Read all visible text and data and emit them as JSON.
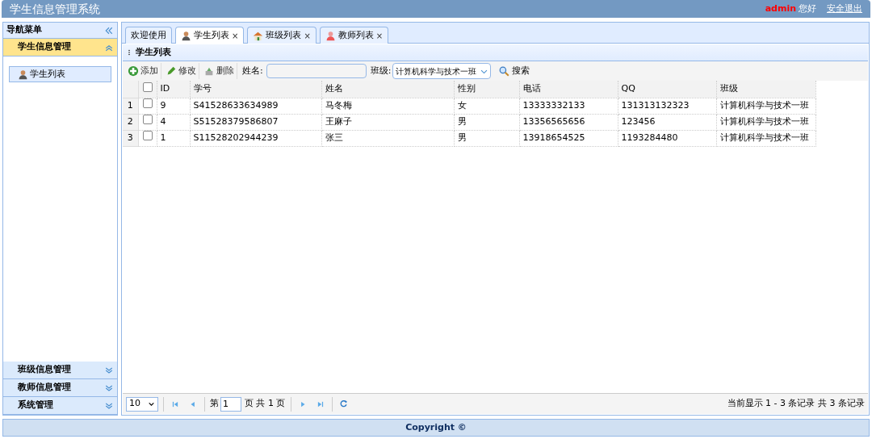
{
  "header": {
    "title": "学生信息管理系统",
    "user": "admin",
    "greeting": "您好",
    "logout": "安全退出"
  },
  "sidebar": {
    "title": "导航菜单",
    "sections": [
      {
        "label": "学生信息管理",
        "expanded": true,
        "items": [
          {
            "label": "学生列表",
            "kind": "student",
            "selected": true
          }
        ]
      },
      {
        "label": "班级信息管理",
        "expanded": false
      },
      {
        "label": "教师信息管理",
        "expanded": false
      },
      {
        "label": "系统管理",
        "expanded": false
      }
    ]
  },
  "tabs": [
    {
      "label": "欢迎使用",
      "kind": "plain",
      "selected": false
    },
    {
      "label": "学生列表",
      "kind": "student",
      "selected": true,
      "close": "×"
    },
    {
      "label": "班级列表",
      "kind": "house",
      "selected": false,
      "close": "×"
    },
    {
      "label": "教师列表",
      "kind": "teacher",
      "selected": false,
      "close": "×"
    }
  ],
  "panel": {
    "title": "学生列表"
  },
  "toolbar": {
    "buttons": [
      {
        "kind": "add",
        "label": "添加"
      },
      {
        "kind": "edit",
        "label": "修改"
      },
      {
        "kind": "delete",
        "label": "删除"
      }
    ],
    "name_label": "姓名:",
    "class_label": "班级:",
    "class_value": "计算机科学与技术一班",
    "search": "搜索"
  },
  "table": {
    "all_checked": false,
    "columns": [
      "ID",
      "学号",
      "姓名",
      "性别",
      "电话",
      "QQ",
      "班级"
    ],
    "rows": [
      {
        "number": "1",
        "checked": false,
        "cells": [
          "9",
          "S41528633634989",
          "马冬梅",
          "女",
          "13333332133",
          "131313132323",
          "计算机科学与技术一班"
        ]
      },
      {
        "number": "2",
        "checked": false,
        "cells": [
          "4",
          "S51528379586807",
          "王麻子",
          "男",
          "13356565656",
          "123456",
          "计算机科学与技术一班"
        ]
      },
      {
        "number": "3",
        "checked": false,
        "cells": [
          "1",
          "S11528202944239",
          "张三",
          "男",
          "13918654525",
          "1193284480",
          "计算机科学与技术一班"
        ]
      }
    ]
  },
  "pager": {
    "page_size": "10",
    "before": "第",
    "page": "1",
    "after": "页 共 1 页",
    "summary": "当前显示 1 - 3 条记录 共 3 条记录"
  },
  "footer": "Copyright ©"
}
